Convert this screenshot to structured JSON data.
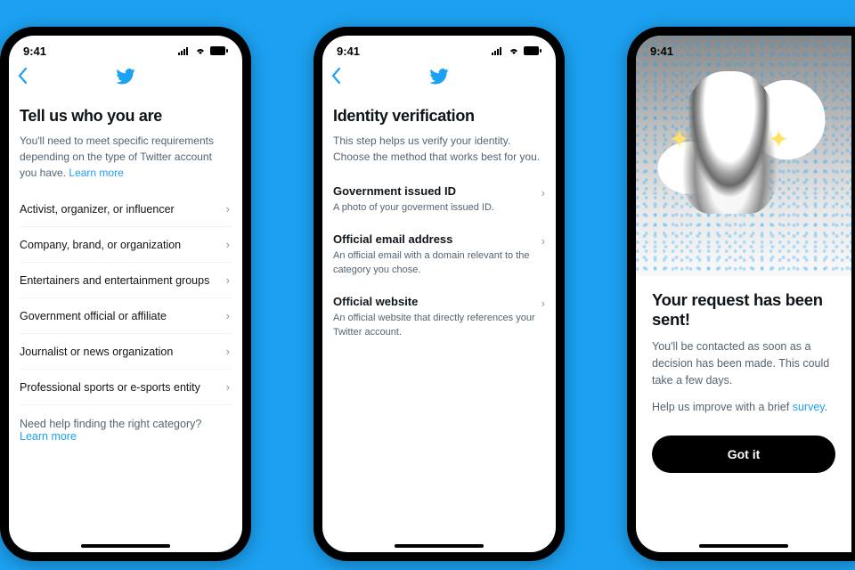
{
  "status": {
    "time": "9:41"
  },
  "screen1": {
    "title": "Tell us who you are",
    "subtitle_a": "You'll need to meet specific requirements depending on the type of Twitter account you have.",
    "learn_more": "Learn more",
    "categories": [
      "Activist, organizer, or influencer",
      "Company, brand, or organization",
      "Entertainers and entertainment groups",
      "Government official or affiliate",
      "Journalist or news organization",
      "Professional sports or e-sports entity"
    ],
    "help_text": "Need help finding the right category?",
    "help_link": "Learn more"
  },
  "screen2": {
    "title": "Identity verification",
    "subtitle": "This step helps us verify your identity. Choose the method that works best for you.",
    "methods": [
      {
        "title": "Government issued ID",
        "desc": "A photo of your goverment issued ID."
      },
      {
        "title": "Official email address",
        "desc": "An official email with a domain relevant to the category you chose."
      },
      {
        "title": "Official website",
        "desc": "An official website that directly references your Twitter account."
      }
    ]
  },
  "screen3": {
    "title": "Your request has been sent!",
    "body": "You'll be contacted as soon as a decision has been made. This could take a few days.",
    "survey_a": "Help us improve with a brief",
    "survey_link": "survey",
    "survey_dot": ".",
    "button": "Got it"
  },
  "colors": {
    "brand": "#1DA1F2"
  }
}
